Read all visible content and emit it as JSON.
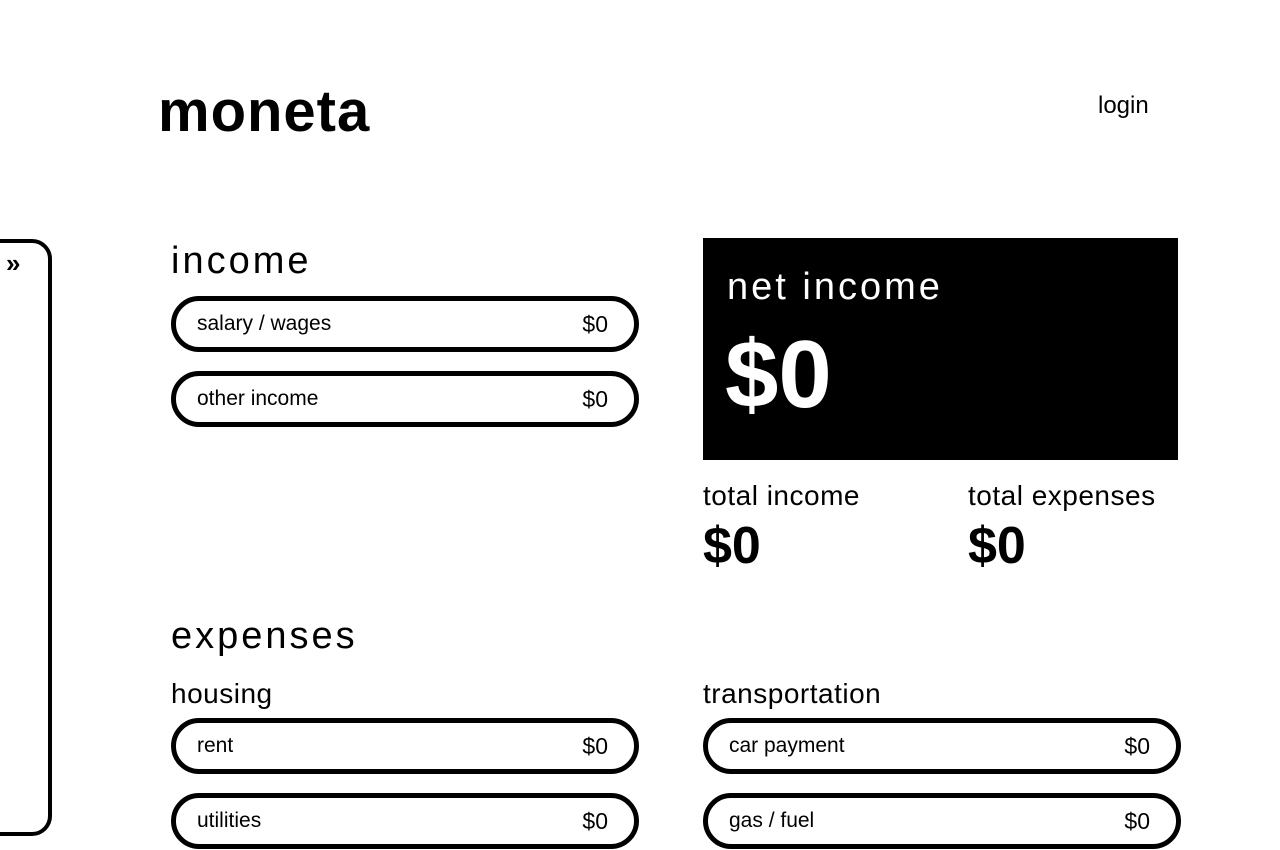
{
  "header": {
    "logo": "moneta",
    "login": "login"
  },
  "sidebar": {
    "toggle_icon": "»"
  },
  "income": {
    "title": "income",
    "items": [
      {
        "label": "salary / wages",
        "value": "$0"
      },
      {
        "label": "other income",
        "value": "$0"
      }
    ]
  },
  "summary": {
    "net_income_label": "net income",
    "net_income_value": "$0",
    "total_income_label": "total income",
    "total_income_value": "$0",
    "total_expenses_label": "total expenses",
    "total_expenses_value": "$0"
  },
  "expenses": {
    "title": "expenses",
    "housing": {
      "title": "housing",
      "items": [
        {
          "label": "rent",
          "value": "$0"
        },
        {
          "label": "utilities",
          "value": "$0"
        }
      ]
    },
    "transportation": {
      "title": "transportation",
      "items": [
        {
          "label": "car payment",
          "value": "$0"
        },
        {
          "label": "gas / fuel",
          "value": "$0"
        }
      ]
    }
  }
}
